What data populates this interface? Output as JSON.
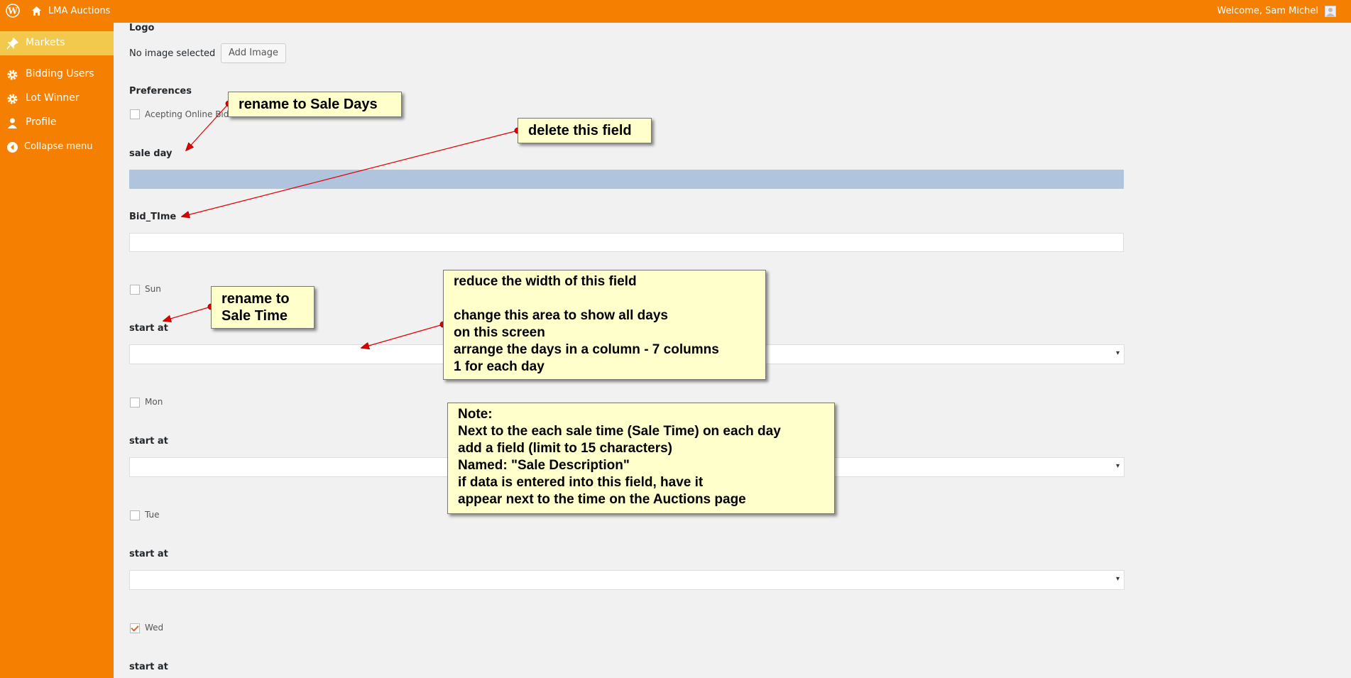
{
  "topbar": {
    "site_name": "LMA Auctions",
    "welcome": "Welcome, Sam Michel",
    "icons": [
      "wordpress-icon",
      "home-icon",
      "avatar-icon"
    ]
  },
  "sidebar": {
    "items": [
      {
        "label": "Markets",
        "icon": "pin-icon",
        "active": true
      },
      {
        "label": "Bidding Users",
        "icon": "gear-icon"
      },
      {
        "label": "Lot Winner",
        "icon": "gear-icon"
      },
      {
        "label": "Profile",
        "icon": "user-icon"
      },
      {
        "label": "Collapse menu",
        "icon": "collapse-icon"
      }
    ],
    "colors": {
      "bar": "#f57f00",
      "active": "#f2c94c"
    }
  },
  "form": {
    "logo_label": "Logo",
    "no_image_text": "No image selected",
    "add_image_button": "Add Image",
    "preferences_label": "Preferences",
    "accepting_online_bids": "Acepting Online Bids",
    "sale_day_label": "sale day",
    "bid_time_label": "Bid_TIme",
    "days": [
      {
        "day": "Sun",
        "start_label": "start at",
        "checked": false
      },
      {
        "day": "Mon",
        "start_label": "start at",
        "checked": false
      },
      {
        "day": "Tue",
        "start_label": "start at",
        "checked": false
      },
      {
        "day": "Wed",
        "start_label": "start at",
        "checked": true
      }
    ],
    "select_arrow": "▾"
  },
  "annotations": {
    "rename_sale_days": "rename to Sale Days",
    "delete_field": "delete this field",
    "rename_sale_time": "rename to\nSale Time",
    "reduce_width": "reduce the width of this field\n\nchange this area to show all days\non this screen\narrange the days in a column - 7 columns\n1 for each day",
    "note": "Note:\nNext to the each sale time (Sale Time) on each day\nadd a field (limit to 15 characters)\nNamed: \"Sale Description\"\nif data is entered into this field, have it\nappear next to the time on the Auctions page"
  }
}
